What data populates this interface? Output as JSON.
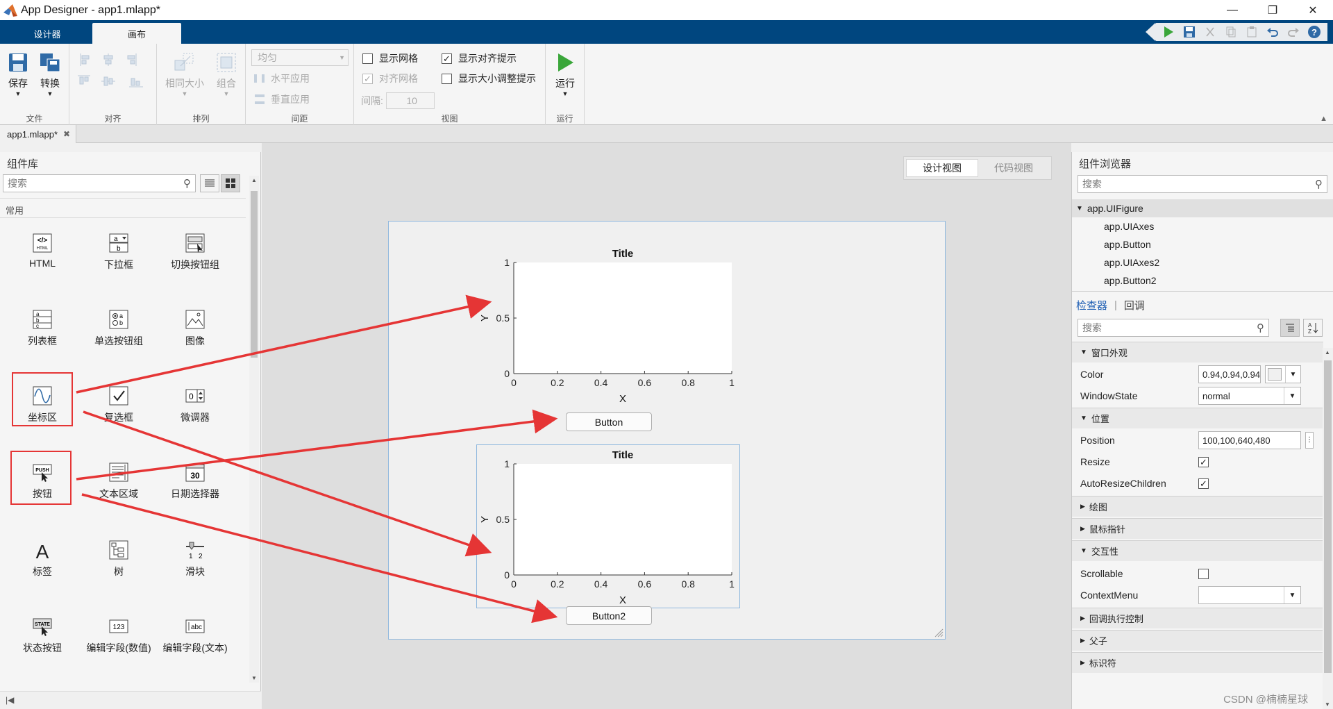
{
  "window": {
    "title": "App Designer - app1.mlapp*"
  },
  "tabs": [
    {
      "label": "设计器"
    },
    {
      "label": "画布"
    }
  ],
  "toolstrip": {
    "file": {
      "save": "保存",
      "convert": "转换",
      "group": "文件"
    },
    "align": {
      "group": "对齐"
    },
    "arrange": {
      "same_size": "相同大小",
      "group_btn": "组合",
      "group": "排列"
    },
    "spacing": {
      "dropdown_value": "均匀",
      "horizontal": "水平应用",
      "vertical": "垂直应用",
      "group": "间距"
    },
    "view": {
      "show_grid": "显示网格",
      "snap_grid": "对齐网格",
      "interval_label": "间隔:",
      "interval_value": "10",
      "show_align_hints": "显示对齐提示",
      "show_resize_hints": "显示大小调整提示",
      "group": "视图"
    },
    "run": {
      "label": "运行",
      "group": "运行"
    }
  },
  "doc_tab": {
    "label": "app1.mlapp*"
  },
  "component_library": {
    "title": "组件库",
    "search_placeholder": "搜索",
    "section": "常用",
    "items": [
      {
        "label": "HTML",
        "icon": "html-icon"
      },
      {
        "label": "下拉框",
        "icon": "dropdown-icon"
      },
      {
        "label": "切换按钮组",
        "icon": "toggle-group-icon"
      },
      {
        "label": "列表框",
        "icon": "listbox-icon"
      },
      {
        "label": "单选按钮组",
        "icon": "radio-group-icon"
      },
      {
        "label": "图像",
        "icon": "image-icon"
      },
      {
        "label": "坐标区",
        "icon": "axes-icon"
      },
      {
        "label": "复选框",
        "icon": "checkbox-icon"
      },
      {
        "label": "微调器",
        "icon": "spinner-icon"
      },
      {
        "label": "按钮",
        "icon": "push-button-icon"
      },
      {
        "label": "文本区域",
        "icon": "text-area-icon"
      },
      {
        "label": "日期选择器",
        "icon": "date-picker-icon"
      },
      {
        "label": "标签",
        "icon": "label-icon"
      },
      {
        "label": "树",
        "icon": "tree-icon"
      },
      {
        "label": "滑块",
        "icon": "slider-icon"
      },
      {
        "label": "状态按钮",
        "icon": "state-button-icon"
      },
      {
        "label": "编辑字段(数值)",
        "icon": "numeric-field-icon"
      },
      {
        "label": "编辑字段(文本)",
        "icon": "text-field-icon"
      }
    ],
    "icon_text": {
      "html": "</>",
      "html_sub": "HTML",
      "push": "PUSH",
      "state": "STATE",
      "date": "30",
      "num": "123",
      "abc": "abc",
      "label_a": "A",
      "dd_a": "a",
      "dd_b": "b",
      "sl_1": "1",
      "sl_2": "2",
      "spin_0": "0"
    }
  },
  "canvas": {
    "view_tabs": [
      "设计视图",
      "代码视图"
    ],
    "axes": [
      {
        "title": "Title",
        "xlabel": "X",
        "ylabel": "Y",
        "xticks": [
          "0",
          "0.2",
          "0.4",
          "0.6",
          "0.8",
          "1"
        ],
        "yticks": [
          "0",
          "0.5",
          "1"
        ]
      },
      {
        "title": "Title",
        "xlabel": "X",
        "ylabel": "Y",
        "xticks": [
          "0",
          "0.2",
          "0.4",
          "0.6",
          "0.8",
          "1"
        ],
        "yticks": [
          "0",
          "0.5",
          "1"
        ]
      }
    ],
    "buttons": [
      "Button",
      "Button2"
    ]
  },
  "component_browser": {
    "title": "组件浏览器",
    "search_placeholder": "搜索",
    "tree": [
      "app.UIFigure",
      "app.UIAxes",
      "app.Button",
      "app.UIAxes2",
      "app.Button2"
    ]
  },
  "inspector": {
    "tabs": [
      "检查器",
      "回调"
    ],
    "search_placeholder": "搜索",
    "sections": {
      "appearance": "窗口外观",
      "position": "位置",
      "plotting": "绘图",
      "pointer": "鼠标指针",
      "interactivity": "交互性",
      "callback_exec": "回调执行控制",
      "parent_child": "父子",
      "identifiers": "标识符"
    },
    "props": {
      "color_name": "Color",
      "color_value": "0.94,0.94,0.94",
      "windowstate_name": "WindowState",
      "windowstate_value": "normal",
      "position_name": "Position",
      "position_value": "100,100,640,480",
      "resize_name": "Resize",
      "autoresize_name": "AutoResizeChildren",
      "scrollable_name": "Scrollable",
      "contextmenu_name": "ContextMenu",
      "contextmenu_value": ""
    }
  },
  "watermark": "CSDN @楠楠星球",
  "colors": {
    "accent": "#00467f",
    "annotation": "#e53535",
    "selection": "#8fb8de",
    "run_green": "#3aa63a"
  }
}
